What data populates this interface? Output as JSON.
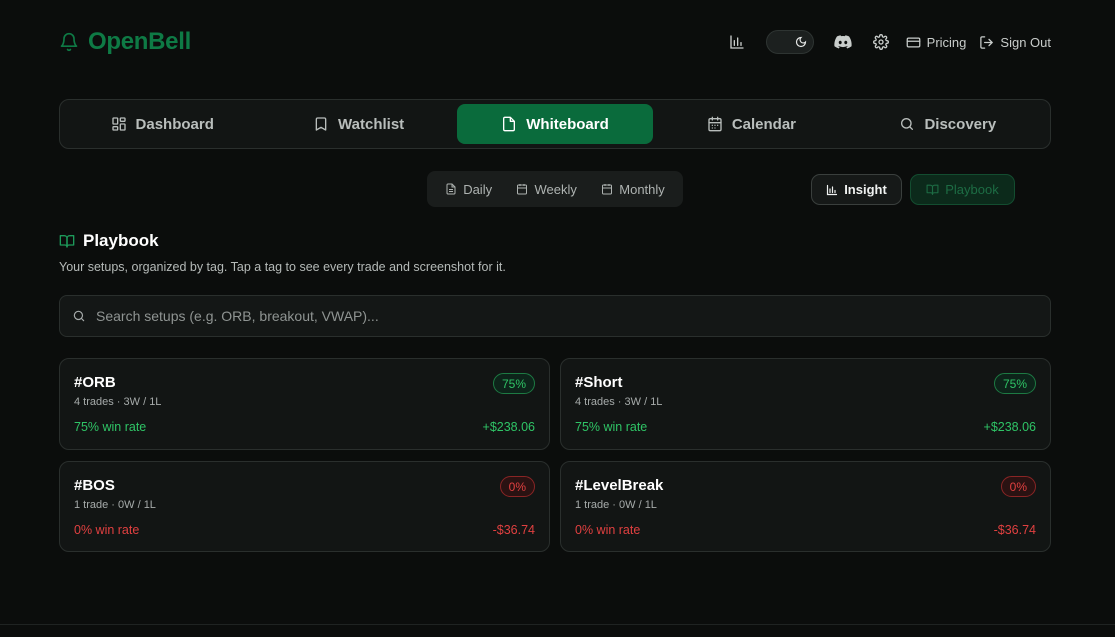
{
  "brand": {
    "name": "OpenBell",
    "color": "#0e7a45"
  },
  "topbar": {
    "chart_icon": "bar-chart-icon",
    "theme_icon": "moon-icon",
    "discord_icon": "discord-icon",
    "settings_icon": "gear-icon",
    "pricing_label": "Pricing",
    "signout_label": "Sign Out"
  },
  "nav": {
    "tabs": [
      {
        "label": "Dashboard",
        "icon": "grid-icon"
      },
      {
        "label": "Watchlist",
        "icon": "bookmark-icon"
      },
      {
        "label": "Whiteboard",
        "icon": "note-icon",
        "active": true
      },
      {
        "label": "Calendar",
        "icon": "calendar-icon"
      },
      {
        "label": "Discovery",
        "icon": "search-icon"
      }
    ],
    "active_color": "#0a6b3c"
  },
  "periods": {
    "daily": "Daily",
    "weekly": "Weekly",
    "monthly": "Monthly"
  },
  "modes": {
    "insight": "Insight",
    "playbook": "Playbook"
  },
  "section": {
    "title": "Playbook",
    "subtitle": "Your setups, organized by tag. Tap a tag to see every trade and screenshot for it."
  },
  "search": {
    "placeholder": "Search setups (e.g. ORB, breakout, VWAP)...",
    "value": ""
  },
  "cards": [
    {
      "tag": "#ORB",
      "meta": "4 trades · 3W / 1L",
      "rate": "75% win rate",
      "pnl": "+$238.06",
      "badge": "75%",
      "status": "win"
    },
    {
      "tag": "#Short",
      "meta": "4 trades · 3W / 1L",
      "rate": "75% win rate",
      "pnl": "+$238.06",
      "badge": "75%",
      "status": "win"
    },
    {
      "tag": "#BOS",
      "meta": "1 trade · 0W / 1L",
      "rate": "0% win rate",
      "pnl": "-$36.74",
      "badge": "0%",
      "status": "loss"
    },
    {
      "tag": "#LevelBreak",
      "meta": "1 trade · 0W / 1L",
      "rate": "0% win rate",
      "pnl": "-$36.74",
      "badge": "0%",
      "status": "loss"
    }
  ],
  "colors": {
    "win": "#2fc466",
    "loss": "#e04040",
    "background": "#0b0d0c"
  }
}
